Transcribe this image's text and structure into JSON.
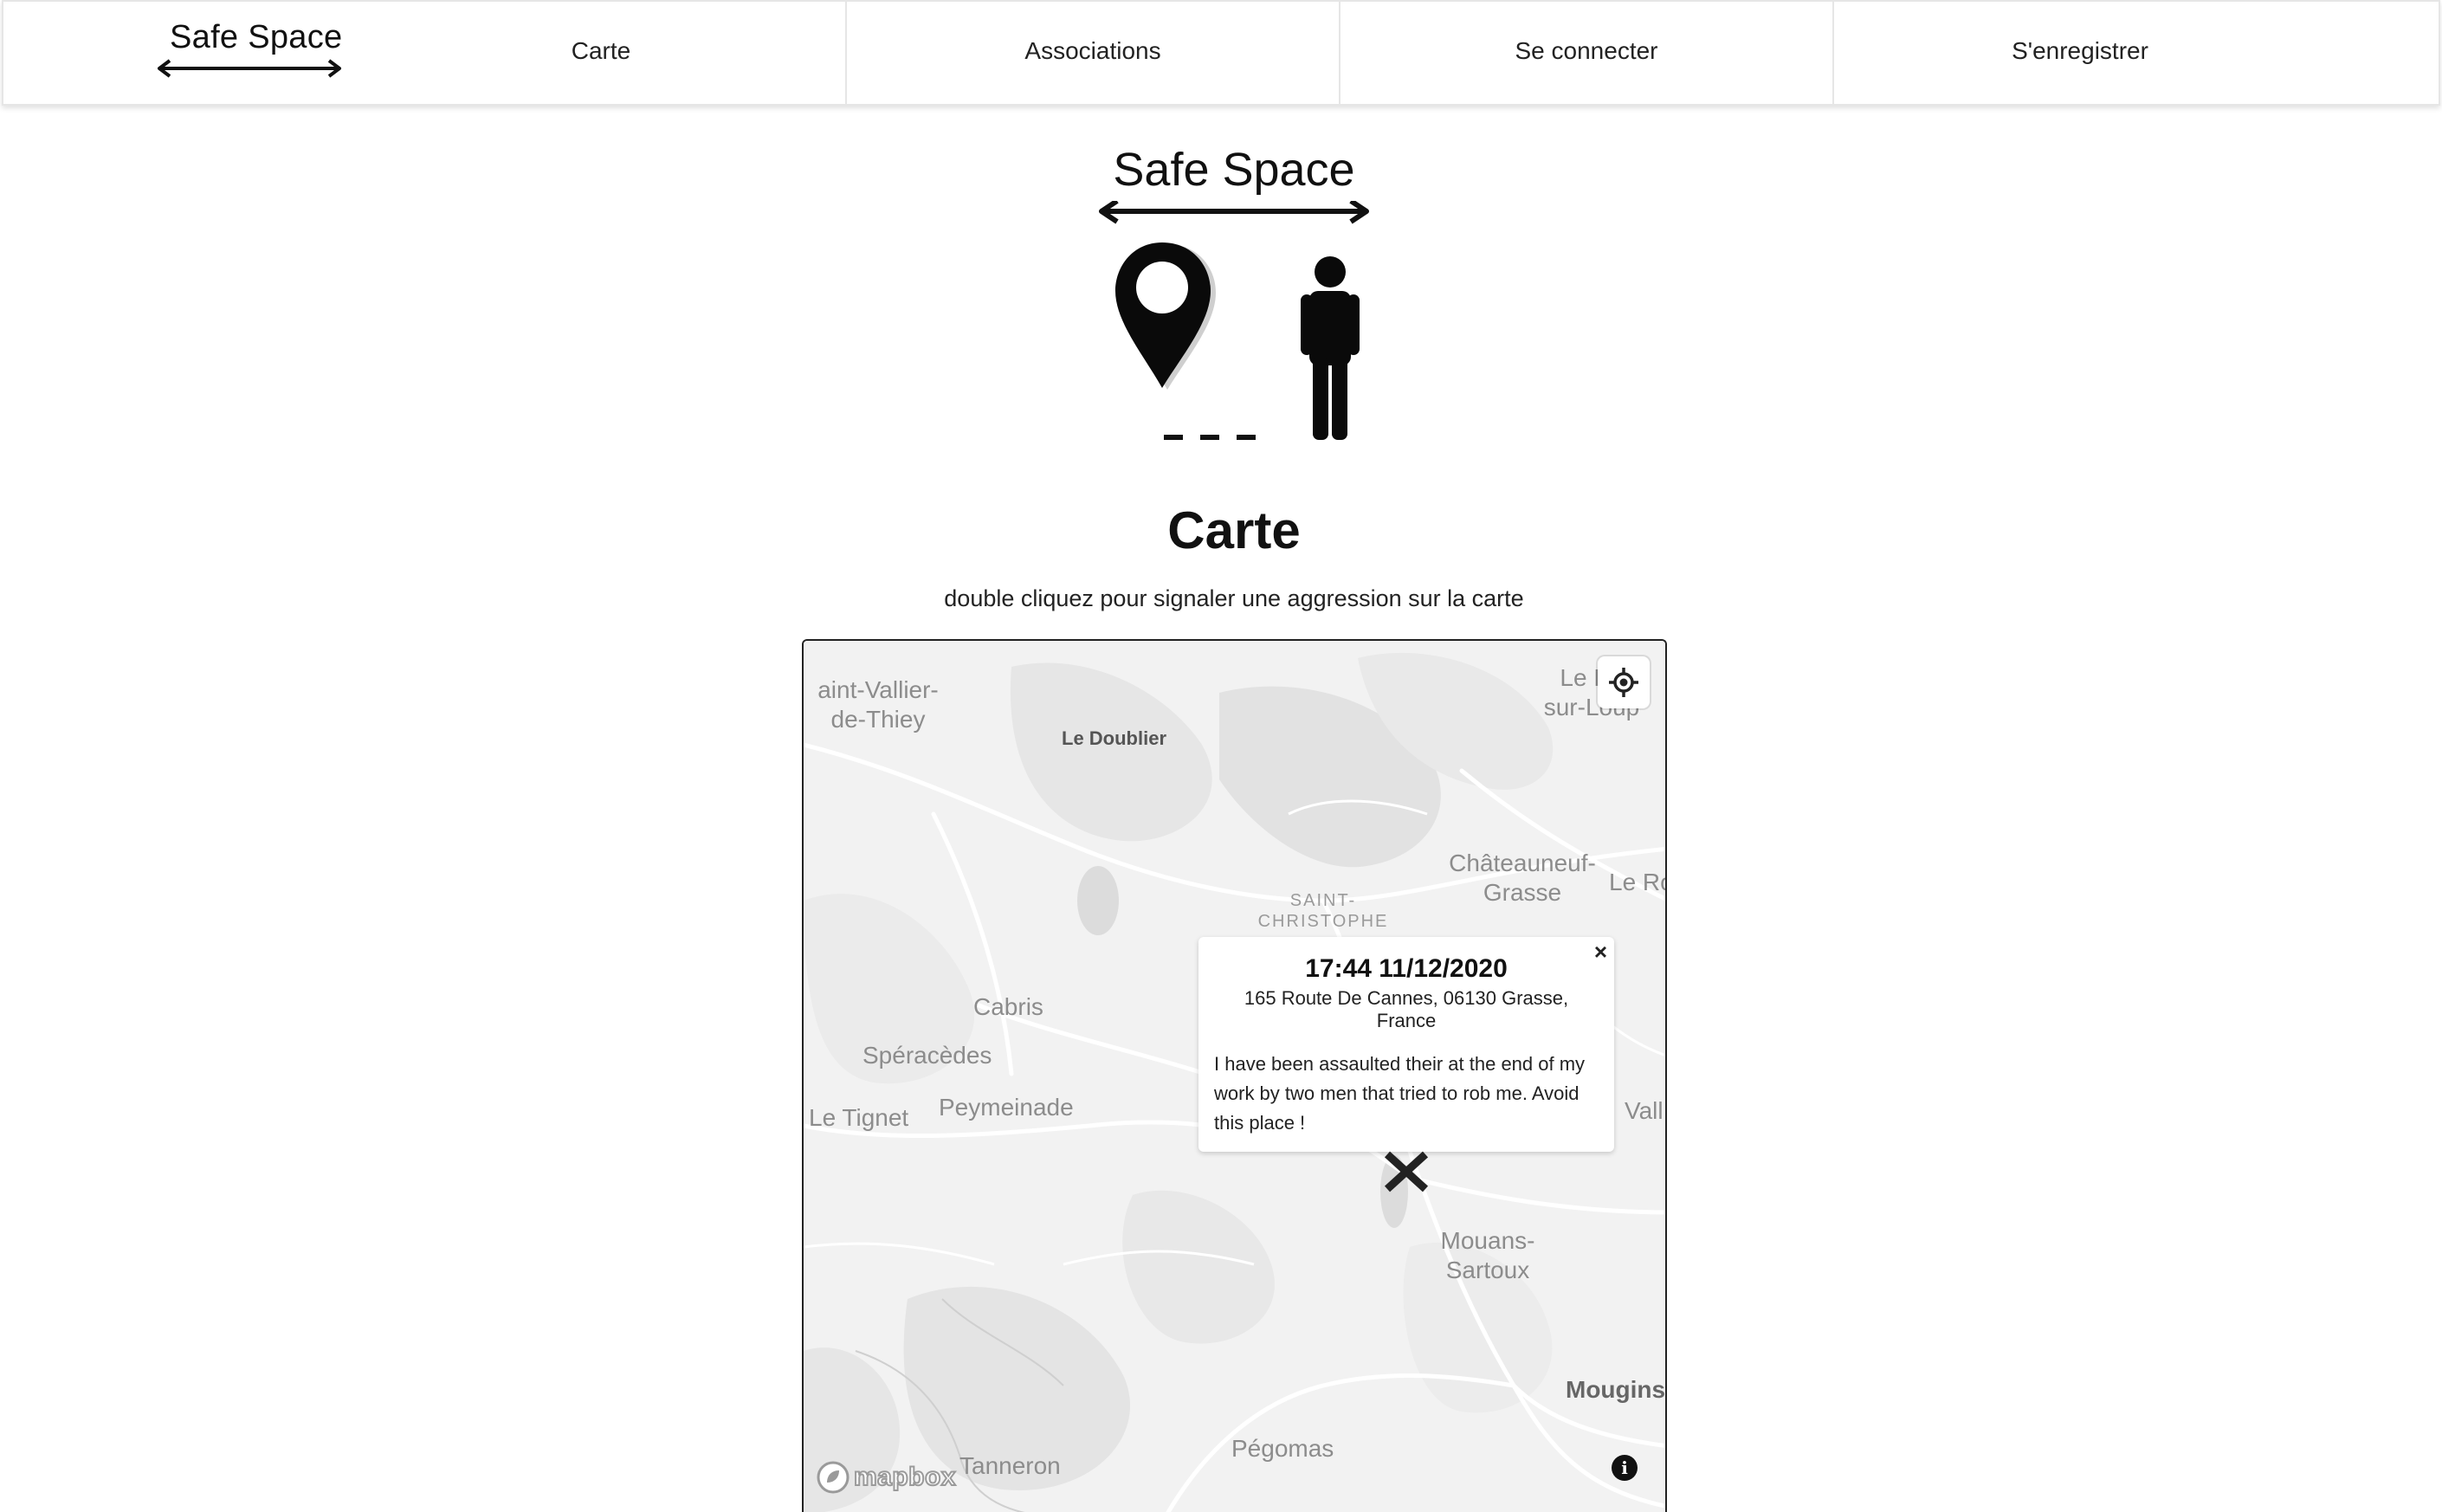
{
  "nav": {
    "logo_text": "Safe Space",
    "items": [
      {
        "label": "Carte"
      },
      {
        "label": "Associations"
      },
      {
        "label": "Se connecter"
      },
      {
        "label": "S'enregistrer"
      }
    ]
  },
  "hero": {
    "title": "Safe Space"
  },
  "page": {
    "title": "Carte",
    "subtitle": "double cliquez pour signaler une aggression sur la carte"
  },
  "map": {
    "places": [
      {
        "name": "aint-Vallier-\nde-Thiey"
      },
      {
        "name": "Le Doublier"
      },
      {
        "name": "Le Ba\nsur-Loup"
      },
      {
        "name": "Châteauneuf-\nGrasse"
      },
      {
        "name": "Le Ro"
      },
      {
        "name": "SAINT-\nCHRISTOPHE"
      },
      {
        "name": "Cabris"
      },
      {
        "name": "Spéracèdes"
      },
      {
        "name": "Le Tignet"
      },
      {
        "name": "Peymeinade"
      },
      {
        "name": "Vall"
      },
      {
        "name": "Mouans-\nSartoux"
      },
      {
        "name": "Mougins"
      },
      {
        "name": "Pégomas"
      },
      {
        "name": "Tanneron"
      }
    ],
    "popup": {
      "close": "×",
      "time": "17:44 11/12/2020",
      "address": "165 Route De Cannes, 06130 Grasse, France",
      "description": "I have been assaulted their at the end of my work by two men that tried to rob me. Avoid this place !"
    },
    "attribution": {
      "logo_text": "mapbox",
      "info": "i"
    }
  }
}
